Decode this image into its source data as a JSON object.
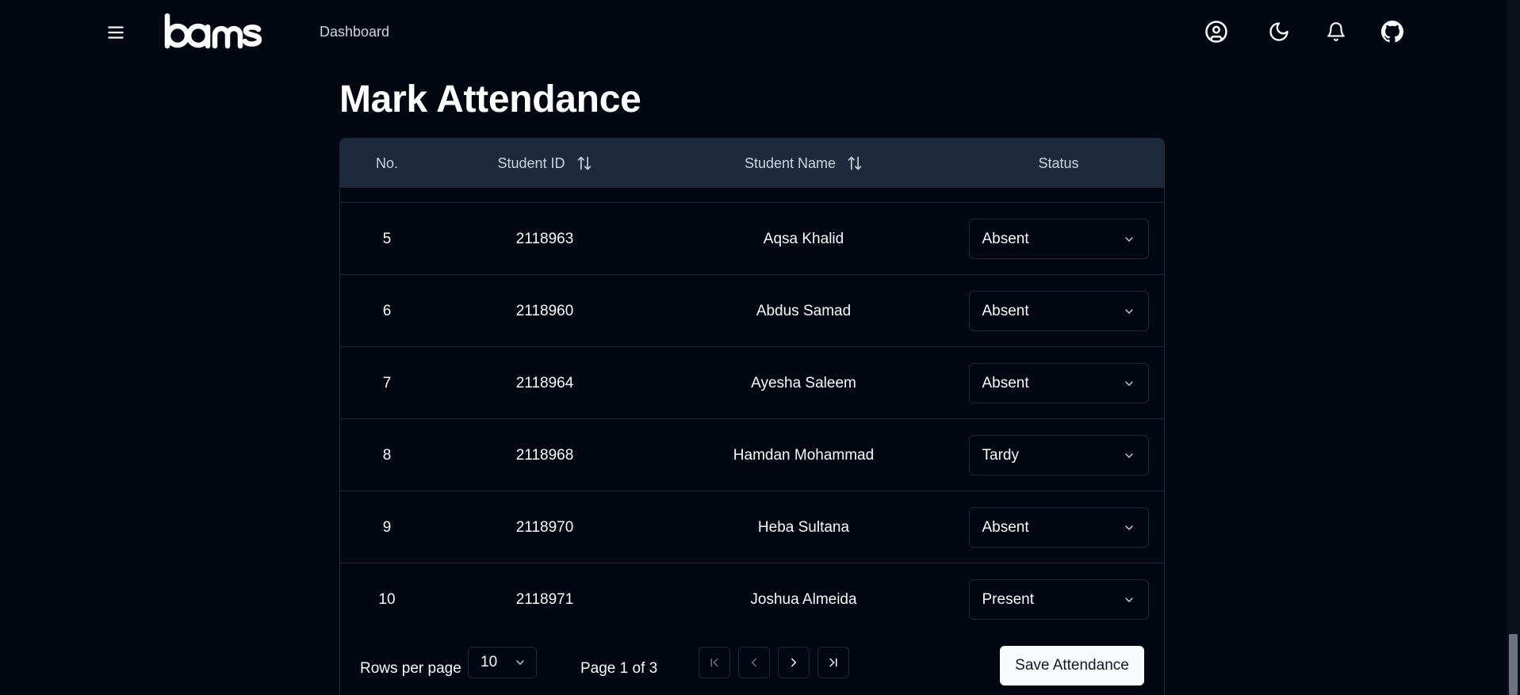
{
  "header": {
    "logo_text": "bams",
    "nav_link": "Dashboard",
    "icons": [
      "menu-icon",
      "user-circle-icon",
      "moon-icon",
      "bell-icon",
      "github-icon"
    ]
  },
  "page": {
    "title": "Mark Attendance"
  },
  "table": {
    "columns": [
      "No.",
      "Student ID",
      "Student Name",
      "Status"
    ],
    "rows": [
      {
        "no": "5",
        "id": "2118963",
        "name": "Aqsa Khalid",
        "status": "Absent"
      },
      {
        "no": "6",
        "id": "2118960",
        "name": "Abdus Samad",
        "status": "Absent"
      },
      {
        "no": "7",
        "id": "2118964",
        "name": "Ayesha Saleem",
        "status": "Absent"
      },
      {
        "no": "8",
        "id": "2118968",
        "name": "Hamdan Mohammad",
        "status": "Tardy"
      },
      {
        "no": "9",
        "id": "2118970",
        "name": "Heba Sultana",
        "status": "Absent"
      },
      {
        "no": "10",
        "id": "2118971",
        "name": "Joshua Almeida",
        "status": "Present"
      }
    ]
  },
  "footer": {
    "rows_per_page_label": "Rows per page",
    "rows_per_page_value": "10",
    "page_info": "Page 1 of 3",
    "save_label": "Save Attendance"
  },
  "colors": {
    "background": "#030712",
    "header_row": "#1e293b",
    "border": "#1e293b",
    "primary_button": "#f8fafc"
  }
}
